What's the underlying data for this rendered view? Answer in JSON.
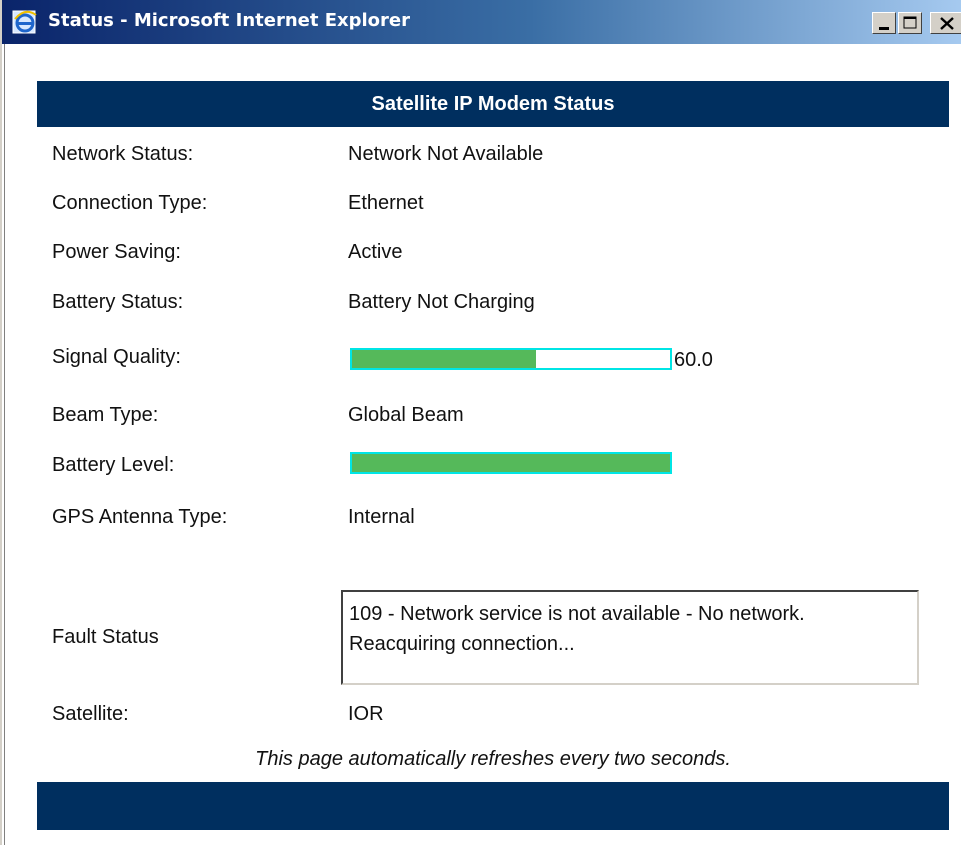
{
  "window": {
    "title": "Status - Microsoft Internet Explorer",
    "icon": "ie-icon",
    "controls": [
      "minimize-icon",
      "maximize-icon",
      "close-icon"
    ]
  },
  "page": {
    "header": "Satellite IP Modem Status",
    "rows": {
      "network_status": {
        "label": "Network Status:",
        "value": "Network Not Available"
      },
      "connection_type": {
        "label": "Connection Type:",
        "value": "Ethernet"
      },
      "power_saving": {
        "label": "Power Saving:",
        "value": "Active"
      },
      "battery_status": {
        "label": "Battery Status:",
        "value": "Battery Not Charging"
      },
      "signal_quality": {
        "label": "Signal Quality:",
        "value": "60.0",
        "fill_fraction": 0.58
      },
      "beam_type": {
        "label": "Beam Type:",
        "value": "Global Beam"
      },
      "battery_level": {
        "label": "Battery Level:",
        "fill_fraction": 1.0
      },
      "gps_antenna_type": {
        "label": "GPS Antenna Type:",
        "value": "Internal"
      },
      "fault_status": {
        "label": "Fault Status",
        "value": "109 - Network service is not available - No network. Reacquiring connection..."
      },
      "satellite": {
        "label": "Satellite:",
        "value": "IOR"
      }
    },
    "refresh_note": "This page automatically refreshes every two seconds."
  },
  "colors": {
    "header_bg": "#002f5f",
    "bar_fill": "#55b95a",
    "bar_border": "#00e5e5"
  }
}
